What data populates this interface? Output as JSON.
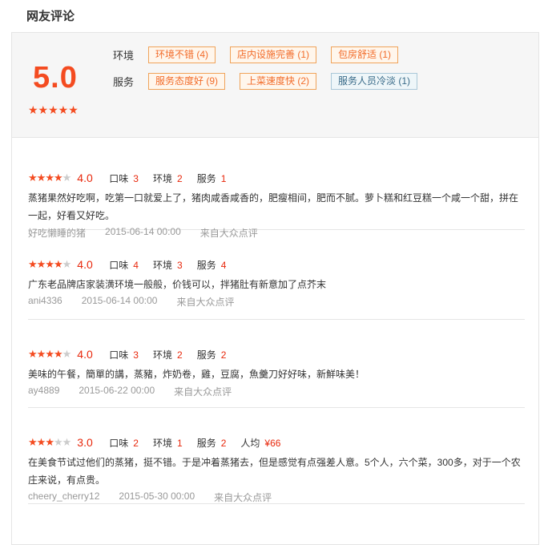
{
  "page_title": "网友评论",
  "summary": {
    "score": "5.0",
    "stars": "★★★★★",
    "rows": [
      {
        "label": "环境",
        "tags": [
          {
            "text": "环境不错 (4)",
            "negative": false
          },
          {
            "text": "店内设施完善 (1)",
            "negative": false
          },
          {
            "text": "包房舒适 (1)",
            "negative": false
          }
        ]
      },
      {
        "label": "服务",
        "tags": [
          {
            "text": "服务态度好 (9)",
            "negative": false
          },
          {
            "text": "上菜速度快 (2)",
            "negative": false
          },
          {
            "text": "服务人员冷淡 (1)",
            "negative": true
          }
        ]
      }
    ]
  },
  "reviews": [
    {
      "stars_on": 4,
      "rating": "4.0",
      "subs": [
        {
          "label": "口味",
          "value": "3"
        },
        {
          "label": "环境",
          "value": "2"
        },
        {
          "label": "服务",
          "value": "1"
        }
      ],
      "text": "蒸猪果然好吃啊，吃第一口就爱上了，猪肉咸香咸香的，肥瘦相间，肥而不腻。萝卜糕和红豆糕一个咸一个甜，拼在一起，好看又好吃。",
      "user": "好吃懒睡的猪",
      "date": "2015-06-14 00:00",
      "source": "来自大众点评"
    },
    {
      "stars_on": 4,
      "rating": "4.0",
      "subs": [
        {
          "label": "口味",
          "value": "4"
        },
        {
          "label": "环境",
          "value": "3"
        },
        {
          "label": "服务",
          "value": "4"
        }
      ],
      "text": "广东老品牌店家装潢环境一般般，价钱可以，拌猪肚有新意加了点芥末",
      "user": "ani4336",
      "date": "2015-06-14 00:00",
      "source": "来自大众点评"
    },
    {
      "stars_on": 4,
      "rating": "4.0",
      "subs": [
        {
          "label": "口味",
          "value": "3"
        },
        {
          "label": "环境",
          "value": "2"
        },
        {
          "label": "服务",
          "value": "2"
        }
      ],
      "text": "美味的午餐，簡單的講，蒸豬，炸奶卷，雞，豆腐，魚羹刀好好味，新鮮味美！",
      "user": "ay4889",
      "date": "2015-06-22 00:00",
      "source": "来自大众点评"
    },
    {
      "stars_on": 3,
      "rating": "3.0",
      "subs": [
        {
          "label": "口味",
          "value": "2"
        },
        {
          "label": "环境",
          "value": "1"
        },
        {
          "label": "服务",
          "value": "2"
        },
        {
          "label": "人均",
          "value": "¥66"
        }
      ],
      "text": "在美食节试过他们的蒸猪，挺不错。于是冲着蒸猪去，但是感觉有点强差人意。5个人，六个菜，300多，对于一个农庄来说，有点贵。",
      "user": "cheery_cherry12",
      "date": "2015-05-30 00:00",
      "source": "来自大众点评"
    }
  ]
}
